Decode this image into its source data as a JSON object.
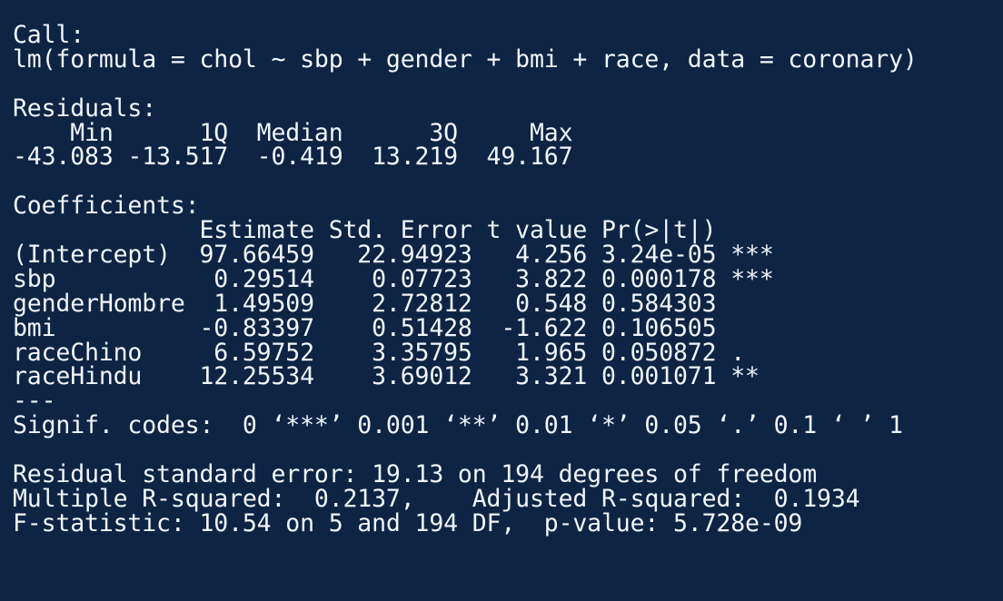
{
  "theme": {
    "background": "#0d2445",
    "foreground": "#f2f5fa"
  },
  "call": {
    "label": "Call:",
    "formula": "lm(formula = chol ~ sbp + gender + bmi + race, data = coronary)"
  },
  "residuals": {
    "label": "Residuals:",
    "header": "    Min      1Q  Median      3Q     Max ",
    "values": "-43.083 -13.517  -0.419  13.219  49.167 "
  },
  "coefficients": {
    "label": "Coefficients:",
    "header": "             Estimate Std. Error t value Pr(>|t|)    ",
    "rows": [
      "(Intercept)  97.66459   22.94923   4.256 3.24e-05 ***",
      "sbp           0.29514    0.07723   3.822 0.000178 ***",
      "genderHombre  1.49509    2.72812   0.548 0.584303    ",
      "bmi          -0.83397    0.51428  -1.622 0.106505    ",
      "raceChino     6.59752    3.35795   1.965 0.050872 .  ",
      "raceHindu    12.25534    3.69012   3.321 0.001071 ** "
    ],
    "separator": "---",
    "signif": "Signif. codes:  0 ‘***’ 0.001 ‘**’ 0.01 ‘*’ 0.05 ‘.’ 0.1 ‘ ’ 1"
  },
  "summary": {
    "rse": "Residual standard error: 19.13 on 194 degrees of freedom",
    "r_squared": "Multiple R-squared:  0.2137,\tAdjusted R-squared:  0.1934 ",
    "f_stat": "F-statistic: 10.54 on 5 and 194 DF,  p-value: 5.728e-09"
  }
}
